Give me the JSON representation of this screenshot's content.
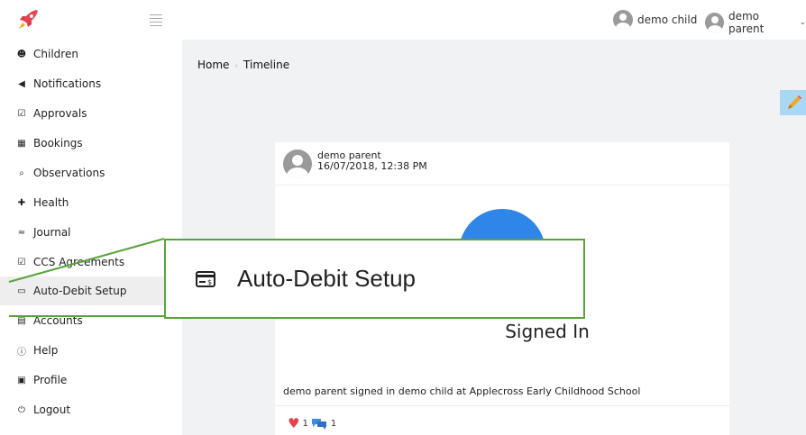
{
  "header": {
    "users": [
      {
        "name": "demo child",
        "has_dropdown": false
      },
      {
        "name": "demo parent",
        "has_dropdown": true
      }
    ],
    "dropdown_glyph": "⌄"
  },
  "sidebar": {
    "items": [
      {
        "label": "Children",
        "icon": "child-icon",
        "glyph": "☻"
      },
      {
        "label": "Notifications",
        "icon": "megaphone-icon",
        "glyph": "◀"
      },
      {
        "label": "Approvals",
        "icon": "checkbox-icon",
        "glyph": "☑"
      },
      {
        "label": "Bookings",
        "icon": "calendar-icon",
        "glyph": "▦"
      },
      {
        "label": "Observations",
        "icon": "search-icon",
        "glyph": "⌕"
      },
      {
        "label": "Health",
        "icon": "health-icon",
        "glyph": "✚"
      },
      {
        "label": "Journal",
        "icon": "journal-icon",
        "glyph": "≈"
      },
      {
        "label": "CCS Agreements",
        "icon": "checkbox-icon",
        "glyph": "☑"
      },
      {
        "label": "Auto-Debit Setup",
        "icon": "payment-card-icon",
        "glyph": "▭",
        "active": true
      },
      {
        "label": "Accounts",
        "icon": "accounts-icon",
        "glyph": "▤"
      },
      {
        "label": "Help",
        "icon": "help-icon",
        "glyph": "ⓘ"
      },
      {
        "label": "Profile",
        "icon": "profile-icon",
        "glyph": "▣"
      },
      {
        "label": "Logout",
        "icon": "power-icon",
        "glyph": "⏻"
      }
    ]
  },
  "breadcrumb": {
    "home": "Home",
    "separator": "›",
    "current": "Timeline"
  },
  "post": {
    "author": "demo parent",
    "timestamp": "16/07/2018, 12:38 PM",
    "event_title": "Signed In",
    "description": "demo parent signed in demo child at Applecross Early Childhood School",
    "likes": "1",
    "comments": "1"
  },
  "callout": {
    "label": "Auto-Debit Setup",
    "icon": "payment-card-icon"
  },
  "colors": {
    "accent_blue": "#2f86e8",
    "highlight_green": "#5aa33c",
    "heart_red": "#e8434d",
    "edit_button_bg": "#a8d8f4"
  }
}
